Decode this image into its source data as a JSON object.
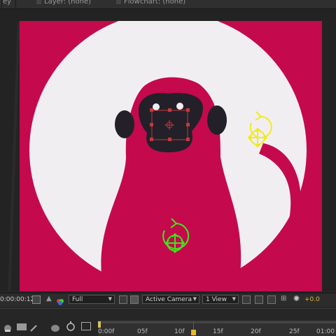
{
  "tabs": {
    "composition": "ey",
    "layer": "Layer: (none)",
    "flowchart": "Flowchart: (none)"
  },
  "viewer_controls": {
    "timecode": "0:00:00:12",
    "resolution": "Full",
    "camera": "Active Camera",
    "views": "1 View",
    "exposure": "+0.0"
  },
  "timeline": {
    "frame_labels": [
      "0:00f",
      "05f",
      "10f",
      "15f",
      "20f",
      "25f",
      "01:00"
    ]
  },
  "colors": {
    "background": "#c40a4c",
    "moon": "#f1eef2",
    "face": "#23202a",
    "anchor_green": "#3fe61a",
    "anchor_yellow": "#f3ea1c",
    "exposure": "#e3b33b"
  }
}
